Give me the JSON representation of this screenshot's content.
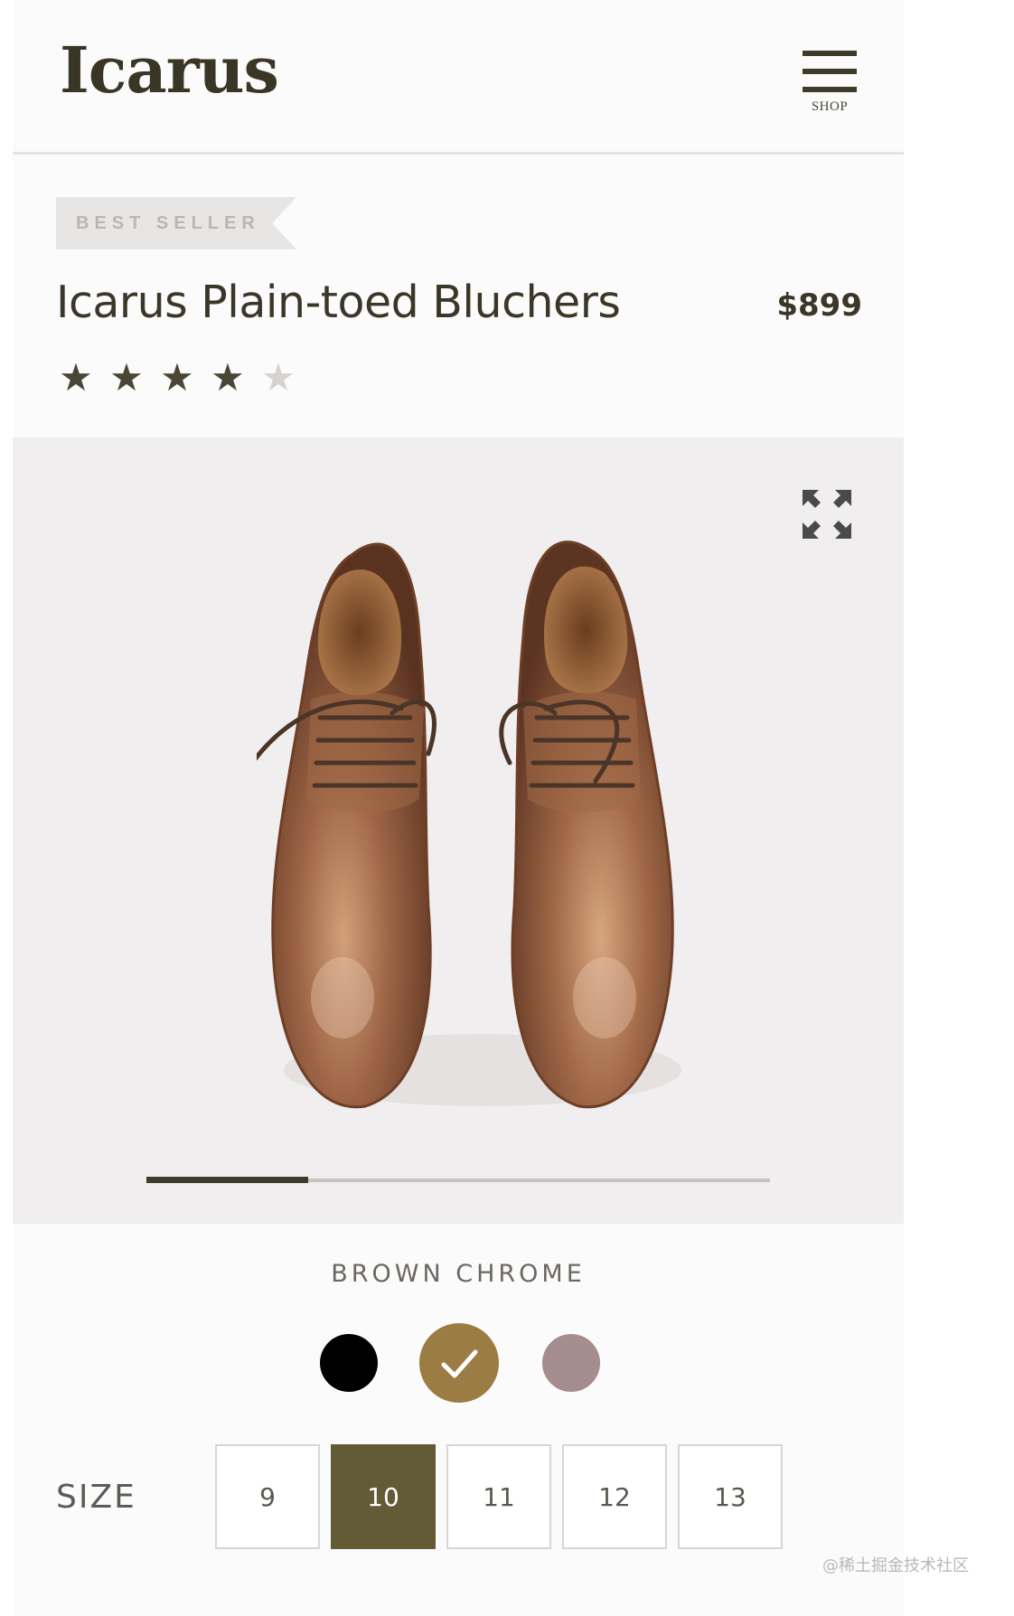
{
  "header": {
    "logo": "Icarus",
    "menu_label": "SHOP"
  },
  "product": {
    "badge": "BEST SELLER",
    "title": "Icarus Plain-toed Bluchers",
    "price": "$899",
    "rating": 4,
    "rating_max": 5,
    "image_progress": 0.26
  },
  "colors": {
    "selected_name": "BROWN CHROME",
    "swatches": [
      {
        "name": "black",
        "hex": "#000000"
      },
      {
        "name": "brown",
        "hex": "#9b7d44",
        "selected": true
      },
      {
        "name": "mauve",
        "hex": "#a58c8e"
      }
    ]
  },
  "size": {
    "label": "SIZE",
    "options": [
      "9",
      "10",
      "11",
      "12",
      "13"
    ],
    "selected": "10"
  },
  "watermark": "@稀土掘金技术社区"
}
